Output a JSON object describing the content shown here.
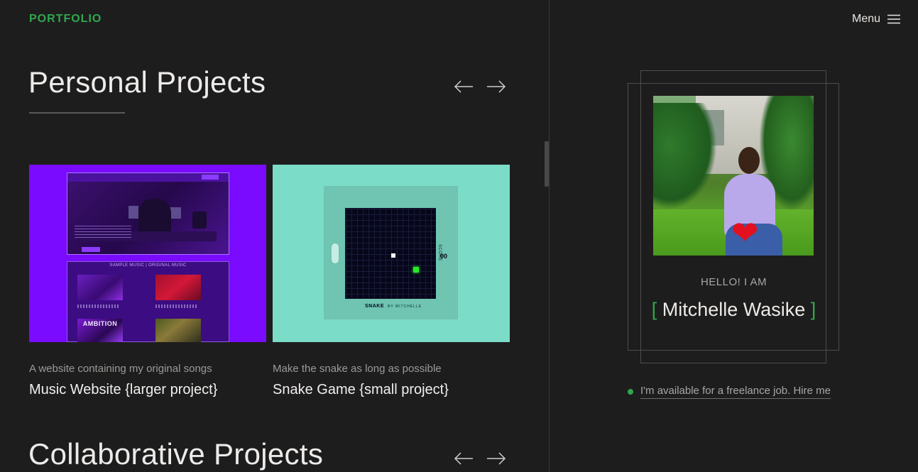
{
  "header": {
    "logo": "PORTFOLIO",
    "menu_label": "Menu"
  },
  "sections": [
    {
      "title": "Personal Projects",
      "projects": [
        {
          "description": "A website containing my original songs",
          "title": "Music Website {larger project}",
          "thumbnail": {
            "songs_heading": "SAMPLE MUSIC | ORIGINAL MUSIC",
            "tile_word": "AMBITION"
          }
        },
        {
          "description": "Make the snake as long as possible",
          "title": "Snake Game {small project}",
          "thumbnail": {
            "game_title": "SNAKE",
            "byline": "BY MITCHELLE",
            "score_label": "SCORE",
            "score": "00"
          }
        }
      ]
    },
    {
      "title": "Collaborative Projects"
    }
  ],
  "profile": {
    "greeting": "HELLO! I AM",
    "name": "Mitchelle Wasike",
    "bracket_open": "[",
    "bracket_close": "]",
    "availability": "I'm available for a freelance job. Hire me"
  },
  "colors": {
    "accent": "#2fa84f",
    "background": "#1e1d1d",
    "music_thumb": "#7a0bff",
    "snake_thumb": "#7bdcc8"
  },
  "icons": [
    "arrow-left-icon",
    "arrow-right-icon",
    "hamburger-icon",
    "heart-icon",
    "status-dot-icon"
  ]
}
